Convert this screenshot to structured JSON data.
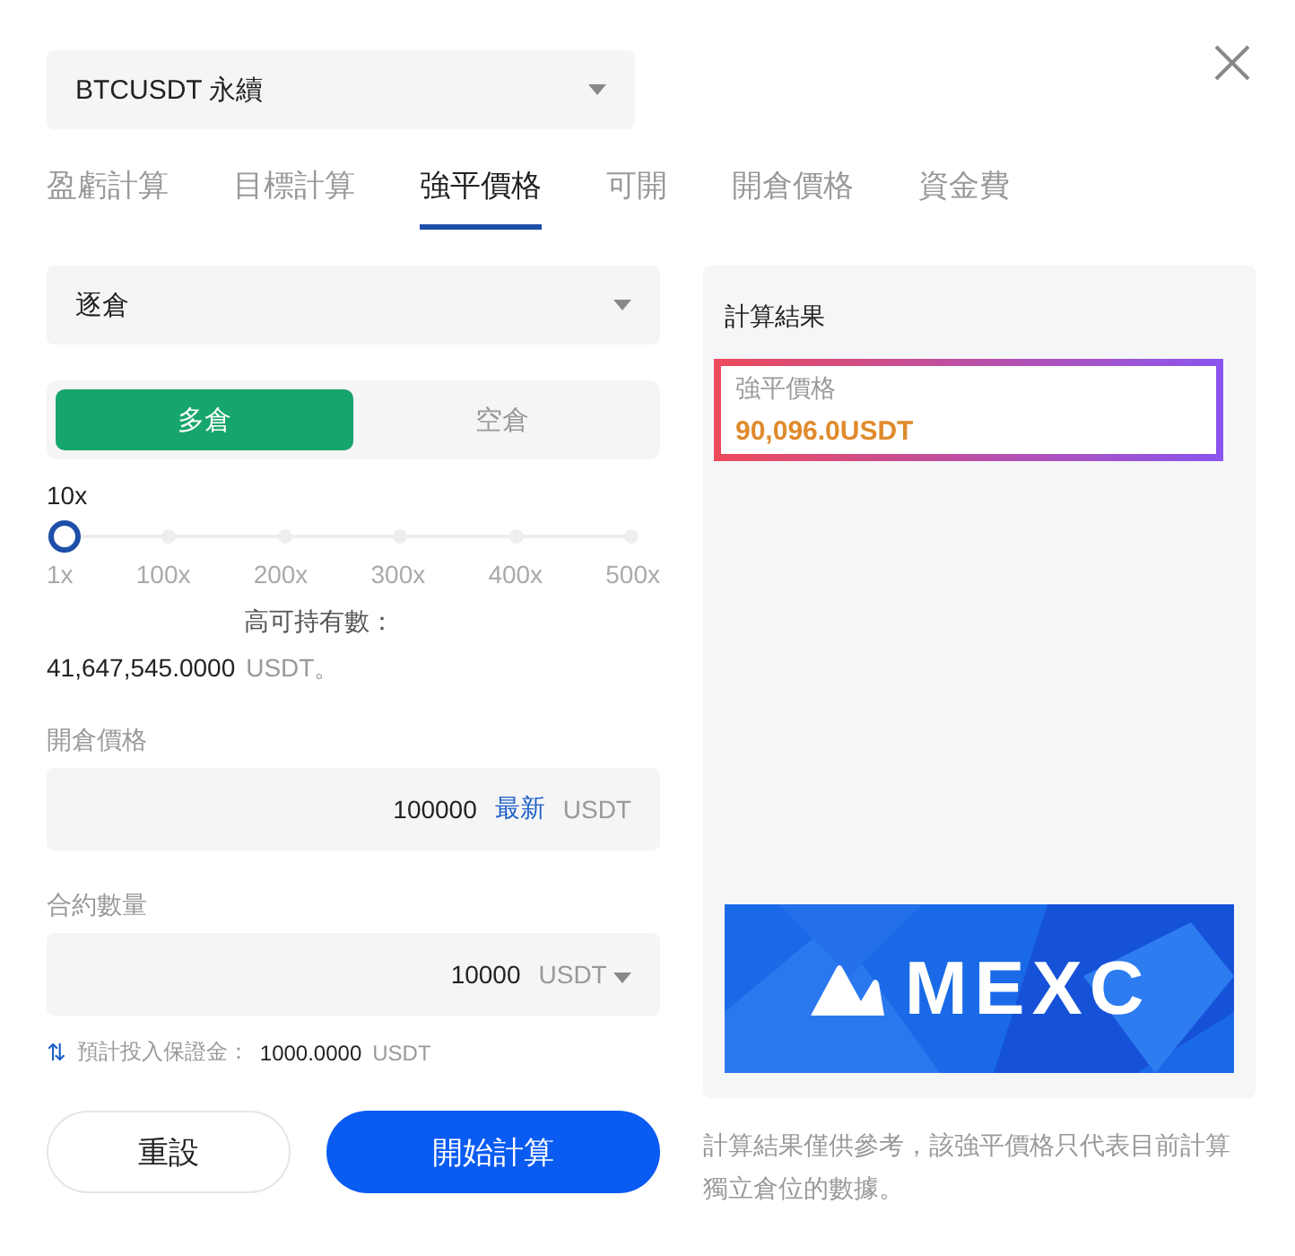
{
  "symbol_select": {
    "value": "BTCUSDT 永續"
  },
  "tabs": [
    {
      "label": "盈虧計算",
      "selected": false
    },
    {
      "label": "目標計算",
      "selected": false
    },
    {
      "label": "強平價格",
      "selected": true
    },
    {
      "label": "可開",
      "selected": false
    },
    {
      "label": "開倉價格",
      "selected": false
    },
    {
      "label": "資金費",
      "selected": false
    }
  ],
  "margin_mode_select": {
    "value": "逐倉"
  },
  "sides": [
    {
      "label": "多倉",
      "selected": true
    },
    {
      "label": "空倉",
      "selected": false
    }
  ],
  "leverage": {
    "value": "10x",
    "level": 0.018,
    "ticks": [
      "1x",
      "100x",
      "200x",
      "300x",
      "400x",
      "500x"
    ]
  },
  "max_position": {
    "label": "高可持有數：",
    "amount": "41,647,545.0000",
    "unit": "USDT。"
  },
  "entry_price": {
    "label": "開倉價格",
    "value": "100000",
    "latest": "最新",
    "unit": "USDT"
  },
  "quantity": {
    "label": "合約數量",
    "value": "10000",
    "unit": "USDT"
  },
  "margin_estimate": {
    "icon": "⇅",
    "label": "預計投入保證金：",
    "value": "1000.0000",
    "unit": "USDT"
  },
  "buttons": [
    {
      "label": "重設",
      "kind": "secondary"
    },
    {
      "label": "開始計算",
      "kind": "primary"
    }
  ],
  "result": {
    "title": "計算結果",
    "label": "強平價格",
    "value": "90,096.0USDT",
    "highlighted": true,
    "banner": "MEXC"
  },
  "disclaimer": "計算結果僅供參考，該強平價格只代表目前計算獨立倉位的數據。"
}
